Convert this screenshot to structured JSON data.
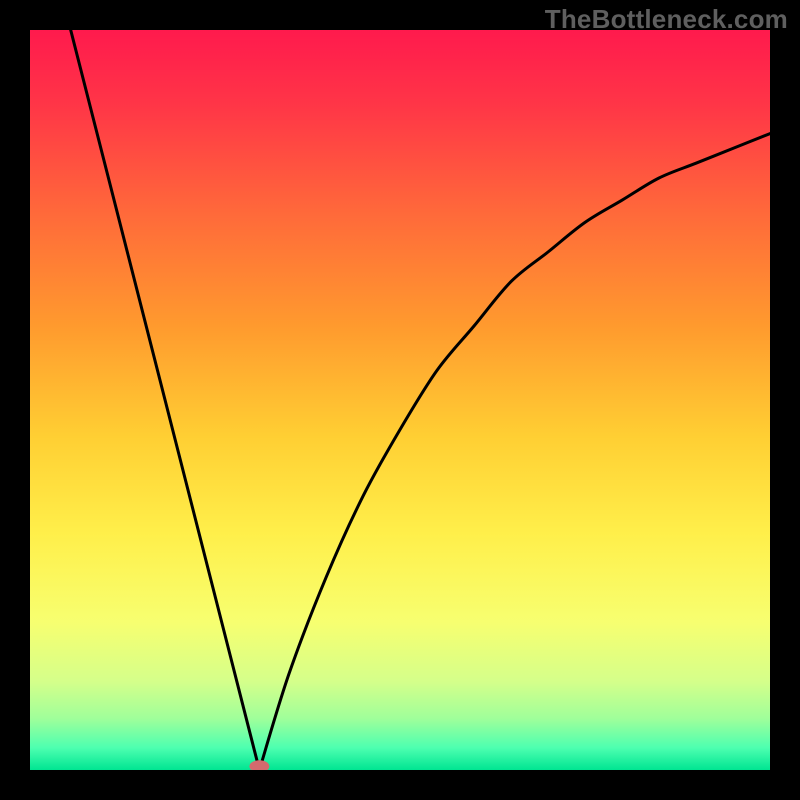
{
  "watermark": "TheBottleneck.com",
  "chart_data": {
    "type": "line",
    "title": "",
    "xlabel": "",
    "ylabel": "",
    "xlim": [
      0,
      1
    ],
    "ylim": [
      0,
      1
    ],
    "note": "V-shaped curve over a vertical rainbow gradient. Left branch nearly straight, descending from upper-left to a minimum; right branch rises concavely toward mid-right. A small pink/red marker sits at the minimum.",
    "minimum": {
      "x": 0.31,
      "y": 0.0
    },
    "marker": {
      "x": 0.31,
      "y": 0.005,
      "color": "#d46a6e"
    },
    "left_branch": {
      "x0": 0.055,
      "y0": 1.0,
      "x1": 0.31,
      "y1": 0.0
    },
    "right_branch_samples": [
      {
        "x": 0.31,
        "y": 0.0
      },
      {
        "x": 0.35,
        "y": 0.13
      },
      {
        "x": 0.4,
        "y": 0.26
      },
      {
        "x": 0.45,
        "y": 0.37
      },
      {
        "x": 0.5,
        "y": 0.46
      },
      {
        "x": 0.55,
        "y": 0.54
      },
      {
        "x": 0.6,
        "y": 0.6
      },
      {
        "x": 0.65,
        "y": 0.66
      },
      {
        "x": 0.7,
        "y": 0.7
      },
      {
        "x": 0.75,
        "y": 0.74
      },
      {
        "x": 0.8,
        "y": 0.77
      },
      {
        "x": 0.85,
        "y": 0.8
      },
      {
        "x": 0.9,
        "y": 0.82
      },
      {
        "x": 0.95,
        "y": 0.84
      },
      {
        "x": 1.0,
        "y": 0.86
      }
    ],
    "gradient_stops": [
      {
        "offset": 0.0,
        "color": "#ff1a4d"
      },
      {
        "offset": 0.1,
        "color": "#ff3547"
      },
      {
        "offset": 0.25,
        "color": "#ff6a3a"
      },
      {
        "offset": 0.4,
        "color": "#ff9a2e"
      },
      {
        "offset": 0.55,
        "color": "#ffcf33"
      },
      {
        "offset": 0.68,
        "color": "#ffef4a"
      },
      {
        "offset": 0.8,
        "color": "#f7ff70"
      },
      {
        "offset": 0.88,
        "color": "#d5ff8a"
      },
      {
        "offset": 0.93,
        "color": "#a0ff9a"
      },
      {
        "offset": 0.97,
        "color": "#4dffb0"
      },
      {
        "offset": 1.0,
        "color": "#00e592"
      }
    ]
  }
}
